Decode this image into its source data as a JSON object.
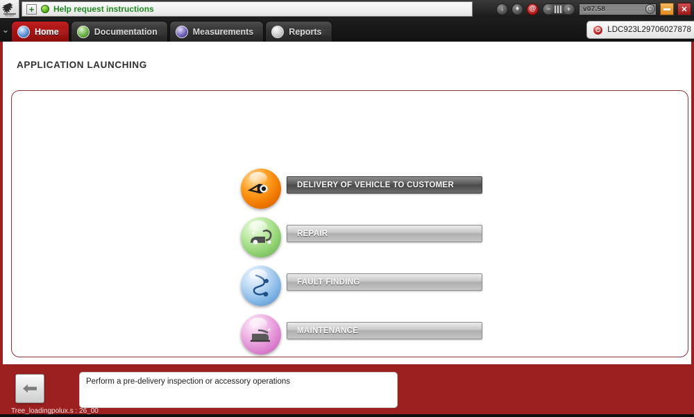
{
  "window": {
    "help_bar": {
      "plus_label": "+",
      "status_icon": "green-status-icon",
      "text": "Help request instructions"
    },
    "toolbar_icons": [
      {
        "name": "download-icon",
        "glyph": "↓"
      },
      {
        "name": "droplet-icon",
        "glyph": "♦"
      },
      {
        "name": "email-alert-icon",
        "glyph": "@"
      }
    ],
    "zoom_group": {
      "minus_label": "−",
      "plus_label": "+"
    },
    "version": "v07.58",
    "controls": {
      "minimize_label": "–",
      "close_label": "✕"
    }
  },
  "tabs": {
    "chevron": "⌄",
    "items": [
      {
        "label": "Home",
        "icon": "globe-icon",
        "active": true
      },
      {
        "label": "Documentation",
        "icon": "document-icon",
        "active": false
      },
      {
        "label": "Measurements",
        "icon": "waveform-icon",
        "active": false
      },
      {
        "label": "Reports",
        "icon": "report-icon",
        "active": false
      }
    ]
  },
  "vin": {
    "icon": "power-icon",
    "value": "LDC923L29706027878"
  },
  "main": {
    "page_title": "APPLICATION LAUNCHING",
    "menu_items": [
      {
        "label": "DELIVERY OF VEHICLE TO CUSTOMER",
        "color": "#ff9e21",
        "icon": "headlight-icon",
        "active": true
      },
      {
        "label": "REPAIR",
        "color": "#8ed070",
        "icon": "wrench-icon",
        "active": false
      },
      {
        "label": "FAULT FINDING",
        "color": "#81b5e6",
        "icon": "stethoscope-icon",
        "active": false
      },
      {
        "label": "MAINTENANCE",
        "color": "#df86d2",
        "icon": "oilcan-icon",
        "active": false
      }
    ]
  },
  "footer": {
    "back_icon": "back-arrow-icon",
    "message": "Perform a pre-delivery inspection or accessory operations",
    "note": "Tree_loadingpolux.s : 26_00"
  }
}
